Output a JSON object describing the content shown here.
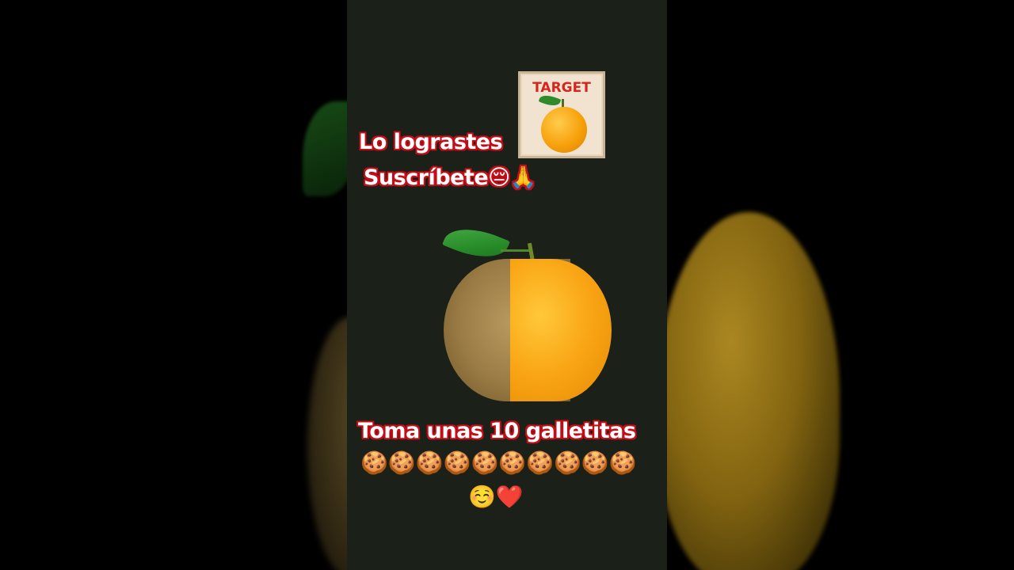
{
  "captions": {
    "line1": "Lo lograstes",
    "line2": "Suscríbete😔🙏",
    "line3": "Toma unas 10 galletitas",
    "cookies": "🍪🍪🍪🍪🍪🍪🍪🍪🍪🍪",
    "ending": "☺️❤️"
  },
  "target_card": {
    "label": "TARGET",
    "icon": "orange-icon"
  },
  "main_image": {
    "icon": "kiwi-orange-hybrid-fruit"
  },
  "colors": {
    "panel_bg": "#1b2019",
    "caption_outline": "#c40d16",
    "target_text": "#d4261f"
  }
}
